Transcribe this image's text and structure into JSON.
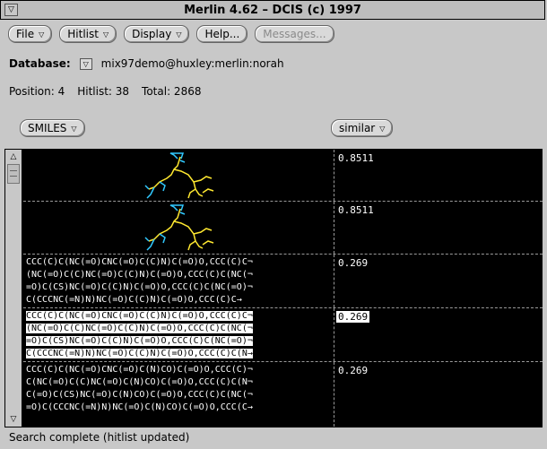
{
  "window": {
    "title": "Merlin 4.62 – DCIS (c) 1997"
  },
  "menu": {
    "file": "File",
    "hitlist": "Hitlist",
    "display": "Display",
    "help": "Help...",
    "messages": "Messages..."
  },
  "database": {
    "label": "Database:",
    "value": "mix97demo@huxley:merlin:norah"
  },
  "position": {
    "position": "Position: 4",
    "hitlist": "Hitlist: 38",
    "total": "Total: 2868"
  },
  "columns": {
    "left": "SMILES",
    "right": "similar"
  },
  "rows": [
    {
      "kind": "structure",
      "score": "0.8511"
    },
    {
      "kind": "structure",
      "score": "0.8511"
    },
    {
      "kind": "smiles",
      "score": "0.269",
      "selected": false,
      "lines": [
        "CCC(C)C(NC(=O)CNC(=O)C(C)N)C(=O)O,CCC(C)C¬",
        "(NC(=O)C(C)NC(=O)C(C)N)C(=O)O,CCC(C)C(NC(¬",
        "=O)C(CS)NC(=O)C(C)N)C(=O)O,CCC(C)C(NC(=O)¬",
        "C(CCCNC(=N)N)NC(=O)C(C)N)C(=O)O,CCC(C)C→"
      ]
    },
    {
      "kind": "smiles",
      "score": "0.269",
      "selected": true,
      "lines": [
        "CCC(C)C(NC(=O)CNC(=O)C(C)N)C(=O)O,CCC(C)C¬",
        "(NC(=O)C(C)NC(=O)C(C)N)C(=O)O,CCC(C)C(NC(¬",
        "=O)C(CS)NC(=O)C(C)N)C(=O)O,CCC(C)C(NC(=O)¬",
        "C(CCCNC(=N)N)NC(=O)C(C)N)C(=O)O,CCC(C)C(N→"
      ]
    },
    {
      "kind": "smiles",
      "score": "0.269",
      "selected": false,
      "lines": [
        "CCC(C)C(NC(=O)CNC(=O)C(N)CO)C(=O)O,CCC(C)¬",
        "C(NC(=O)C(C)NC(=O)C(N)CO)C(=O)O,CCC(C)C(N¬",
        "C(=O)C(CS)NC(=O)C(N)CO)C(=O)O,CCC(C)C(NC(¬",
        "=O)C(CCCNC(=N)N)NC(=O)C(N)CO)C(=O)O,CCC(C→"
      ]
    }
  ],
  "status": "Search complete (hitlist updated)"
}
